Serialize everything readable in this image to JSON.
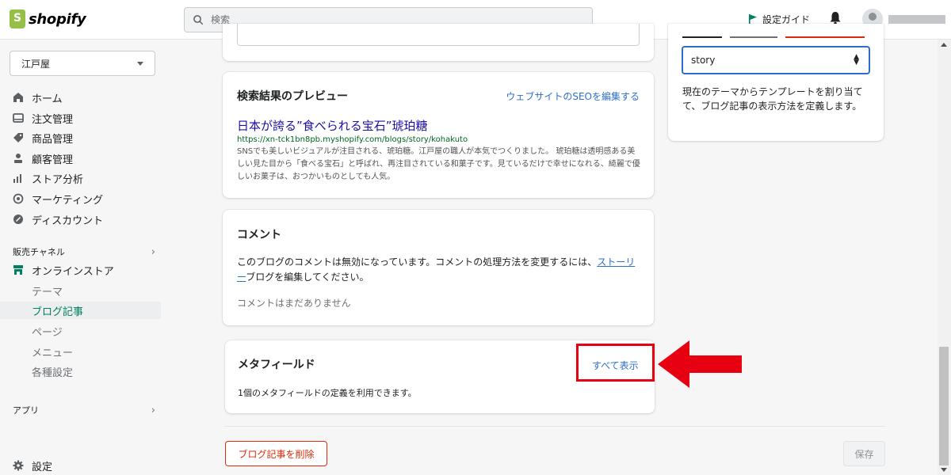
{
  "app": {
    "logo_text": "shopify"
  },
  "topbar": {
    "search_placeholder": "検索",
    "setup_guide_label": "設定ガイド"
  },
  "sidebar": {
    "store_name": "江戸屋",
    "nav": [
      {
        "label": "ホーム",
        "icon": "home-icon"
      },
      {
        "label": "注文管理",
        "icon": "orders-icon"
      },
      {
        "label": "商品管理",
        "icon": "tag-icon"
      },
      {
        "label": "顧客管理",
        "icon": "person-icon"
      },
      {
        "label": "ストア分析",
        "icon": "analytics-icon"
      },
      {
        "label": "マーケティング",
        "icon": "marketing-icon"
      },
      {
        "label": "ディスカウント",
        "icon": "discount-icon"
      }
    ],
    "sales_channels_label": "販売チャネル",
    "online_store_label": "オンラインストア",
    "online_store_sub": [
      "テーマ",
      "ブログ記事",
      "ページ",
      "メニュー",
      "各種設定"
    ],
    "active_sub": "ブログ記事",
    "apps_label": "アプリ",
    "settings_label": "設定"
  },
  "seo_preview": {
    "title": "検索結果のプレビュー",
    "edit_link": "ウェブサイトのSEOを編集する",
    "result_title": "日本が誇る”食べられる宝石”琥珀糖",
    "result_url": "https://xn-tck1bn8pb.myshopify.com/blogs/story/kohakuto",
    "result_desc": "SNSでも美しいビジュアルが注目される、琥珀糖。江戸屋の職人が本気でつくりました。 琥珀糖は透明感ある美しい見た目から「食べる宝石」と呼ばれ、再注目されている和菓子です。見ているだけで幸せになれる、綺麗で優しいお菓子は、おつかいものとしても人気。"
  },
  "comments": {
    "title": "コメント",
    "text_before": "このブログのコメントは無効になっています。コメントの処理方法を変更するには、",
    "link": "ストーリー",
    "text_after": "ブログを編集してください。",
    "empty": "コメントはまだありません"
  },
  "metafields": {
    "title": "メタフィールド",
    "show_all": "すべて表示",
    "description": "1個のメタフィールドの定義を利用できます。"
  },
  "template": {
    "selected": "story",
    "help": "現在のテーマからテンプレートを割り当てて、ブログ記事の表示方法を定義します。"
  },
  "footer": {
    "delete_label": "ブログ記事を削除",
    "save_label": "保存"
  },
  "colors": {
    "accent_green": "#008060",
    "link_blue": "#2c6ecb",
    "annotation_red": "#e60012"
  }
}
